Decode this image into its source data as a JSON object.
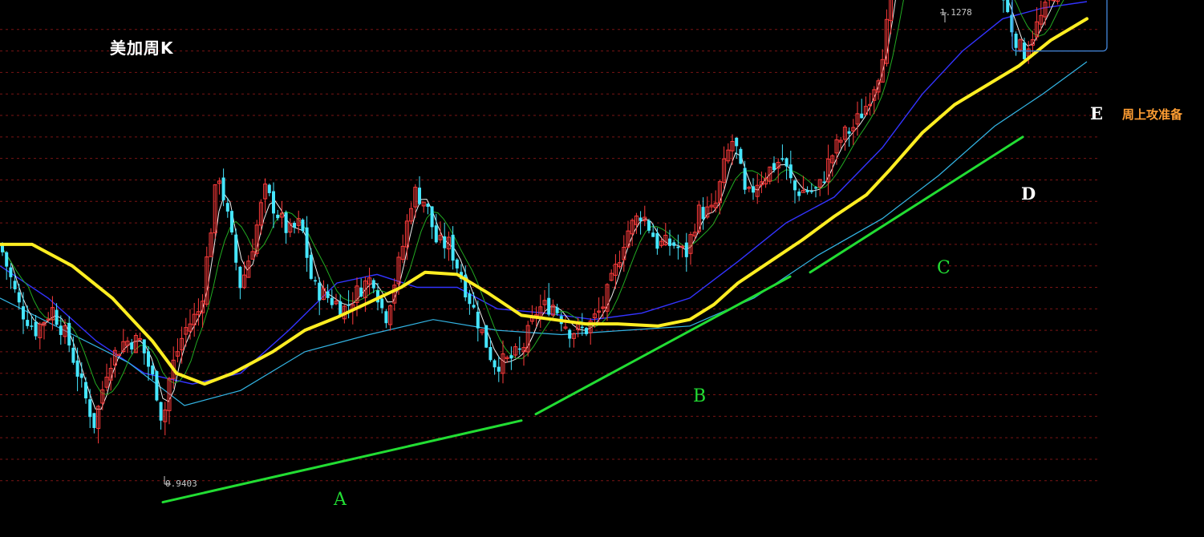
{
  "title": "美加周K",
  "note": "周上攻准备",
  "price_high": "1.1278",
  "price_low": "0.9403",
  "wave_labels": {
    "a": "A",
    "b": "B",
    "c": "C",
    "d": "D",
    "e": "E"
  },
  "colors": {
    "background": "#000000",
    "grid": "#7a1414",
    "candle_up": "#ff3b3b",
    "candle_down": "#46e6ff",
    "ma_thick": "#ffee22",
    "ma_blue": "#3333ff",
    "ma_cyan": "#33b5e5",
    "ma_white": "#f0f0f0",
    "ma_green": "#22aa22",
    "trendline": "#22dd33",
    "highlight_box": "#4488dd",
    "note": "#ff9e33"
  },
  "chart_data": {
    "type": "candlestick",
    "title": "美加周K",
    "price_high": 1.1278,
    "price_low": 0.9403,
    "ylim": [
      0.905,
      1.14
    ],
    "grid": true,
    "y_gridlines": [
      0.92,
      0.93,
      0.94,
      0.95,
      0.96,
      0.97,
      0.98,
      0.99,
      1.0,
      1.01,
      1.02,
      1.03,
      1.04,
      1.05,
      1.06,
      1.07,
      1.08,
      1.09,
      1.1,
      1.11,
      1.12,
      1.13
    ],
    "close_path": [
      [
        0,
        1.03
      ],
      [
        25,
        1.0
      ],
      [
        45,
        0.99
      ],
      [
        65,
        1.0
      ],
      [
        85,
        0.985
      ],
      [
        105,
        0.96
      ],
      [
        118,
        0.946
      ],
      [
        135,
        0.975
      ],
      [
        155,
        0.985
      ],
      [
        175,
        0.985
      ],
      [
        195,
        0.962
      ],
      [
        203,
        0.946
      ],
      [
        212,
        0.97
      ],
      [
        230,
        0.99
      ],
      [
        250,
        1.0
      ],
      [
        262,
        1.035
      ],
      [
        272,
        1.065
      ],
      [
        285,
        1.04
      ],
      [
        300,
        1.01
      ],
      [
        315,
        1.03
      ],
      [
        330,
        1.055
      ],
      [
        345,
        1.045
      ],
      [
        360,
        1.035
      ],
      [
        375,
        1.04
      ],
      [
        390,
        1.01
      ],
      [
        410,
        1.005
      ],
      [
        430,
        1.0
      ],
      [
        450,
        1.01
      ],
      [
        465,
        1.015
      ],
      [
        480,
        0.995
      ],
      [
        500,
        1.025
      ],
      [
        515,
        1.055
      ],
      [
        530,
        1.05
      ],
      [
        545,
        1.03
      ],
      [
        560,
        1.03
      ],
      [
        580,
        1.01
      ],
      [
        600,
        0.99
      ],
      [
        615,
        0.975
      ],
      [
        630,
        0.975
      ],
      [
        650,
        0.98
      ],
      [
        670,
        1.0
      ],
      [
        690,
        1.002
      ],
      [
        710,
        0.99
      ],
      [
        730,
        0.99
      ],
      [
        750,
        1.0
      ],
      [
        765,
        1.015
      ],
      [
        780,
        1.035
      ],
      [
        800,
        1.045
      ],
      [
        820,
        1.03
      ],
      [
        840,
        1.03
      ],
      [
        855,
        1.025
      ],
      [
        870,
        1.045
      ],
      [
        890,
        1.045
      ],
      [
        905,
        1.07
      ],
      [
        915,
        1.08
      ],
      [
        930,
        1.05
      ],
      [
        945,
        1.06
      ],
      [
        960,
        1.065
      ],
      [
        975,
        1.07
      ],
      [
        990,
        1.055
      ],
      [
        1005,
        1.055
      ],
      [
        1020,
        1.055
      ],
      [
        1035,
        1.07
      ],
      [
        1050,
        1.08
      ],
      [
        1065,
        1.085
      ],
      [
        1080,
        1.095
      ],
      [
        1095,
        1.11
      ],
      [
        1105,
        1.13
      ],
      [
        1115,
        1.16
      ],
      [
        1125,
        1.185
      ],
      [
        1140,
        1.185
      ],
      [
        1155,
        1.19
      ],
      [
        1165,
        1.195
      ],
      [
        1178,
        1.205
      ],
      [
        1190,
        1.18
      ],
      [
        1205,
        1.175
      ],
      [
        1220,
        1.155
      ],
      [
        1235,
        1.155
      ],
      [
        1250,
        1.145
      ],
      [
        1262,
        1.13
      ],
      [
        1275,
        1.118
      ],
      [
        1290,
        1.13
      ],
      [
        1305,
        1.14
      ],
      [
        1320,
        1.155
      ],
      [
        1335,
        1.158
      ],
      [
        1345,
        1.165
      ],
      [
        1353,
        1.19
      ]
    ],
    "ma_thick": [
      [
        0,
        1.03
      ],
      [
        40,
        1.03
      ],
      [
        90,
        1.02
      ],
      [
        140,
        1.005
      ],
      [
        190,
        0.985
      ],
      [
        220,
        0.97
      ],
      [
        255,
        0.965
      ],
      [
        290,
        0.97
      ],
      [
        340,
        0.98
      ],
      [
        380,
        0.99
      ],
      [
        420,
        0.996
      ],
      [
        460,
        1.003
      ],
      [
        500,
        1.01
      ],
      [
        530,
        1.017
      ],
      [
        570,
        1.016
      ],
      [
        610,
        1.007
      ],
      [
        650,
        0.997
      ],
      [
        690,
        0.995
      ],
      [
        730,
        0.993
      ],
      [
        770,
        0.993
      ],
      [
        820,
        0.992
      ],
      [
        860,
        0.995
      ],
      [
        890,
        1.002
      ],
      [
        920,
        1.012
      ],
      [
        960,
        1.022
      ],
      [
        1000,
        1.032
      ],
      [
        1040,
        1.043
      ],
      [
        1080,
        1.053
      ],
      [
        1110,
        1.065
      ],
      [
        1150,
        1.082
      ],
      [
        1190,
        1.095
      ],
      [
        1230,
        1.104
      ],
      [
        1270,
        1.113
      ],
      [
        1310,
        1.125
      ],
      [
        1355,
        1.135
      ]
    ],
    "ma_blue": [
      [
        0,
        1.02
      ],
      [
        60,
        1.005
      ],
      [
        120,
        0.985
      ],
      [
        180,
        0.97
      ],
      [
        240,
        0.965
      ],
      [
        300,
        0.97
      ],
      [
        360,
        0.99
      ],
      [
        420,
        1.012
      ],
      [
        470,
        1.016
      ],
      [
        520,
        1.01
      ],
      [
        570,
        1.01
      ],
      [
        620,
        1.0
      ],
      [
        680,
        0.998
      ],
      [
        740,
        0.995
      ],
      [
        800,
        0.998
      ],
      [
        860,
        1.005
      ],
      [
        920,
        1.022
      ],
      [
        980,
        1.04
      ],
      [
        1040,
        1.052
      ],
      [
        1100,
        1.075
      ],
      [
        1150,
        1.1
      ],
      [
        1200,
        1.12
      ],
      [
        1250,
        1.135
      ],
      [
        1300,
        1.14
      ],
      [
        1355,
        1.143
      ]
    ],
    "ma_cyan": [
      [
        0,
        1.005
      ],
      [
        80,
        0.99
      ],
      [
        160,
        0.975
      ],
      [
        230,
        0.955
      ],
      [
        300,
        0.962
      ],
      [
        380,
        0.98
      ],
      [
        460,
        0.988
      ],
      [
        540,
        0.995
      ],
      [
        620,
        0.99
      ],
      [
        700,
        0.988
      ],
      [
        780,
        0.99
      ],
      [
        860,
        0.992
      ],
      [
        940,
        1.005
      ],
      [
        1020,
        1.025
      ],
      [
        1100,
        1.042
      ],
      [
        1170,
        1.062
      ],
      [
        1240,
        1.085
      ],
      [
        1300,
        1.1
      ],
      [
        1355,
        1.115
      ]
    ],
    "trendlines": [
      {
        "label": "A",
        "from": [
          203,
          0.91
        ],
        "to": [
          650,
          0.948
        ]
      },
      {
        "label": "B",
        "from": [
          668,
          0.951
        ],
        "to": [
          985,
          1.015
        ]
      },
      {
        "label": "C",
        "from": [
          1010,
          1.017
        ],
        "to": [
          1275,
          1.08
        ]
      }
    ],
    "highlight_box": {
      "from": [
        1262,
        1.12
      ],
      "to": [
        1380,
        1.173
      ]
    }
  }
}
